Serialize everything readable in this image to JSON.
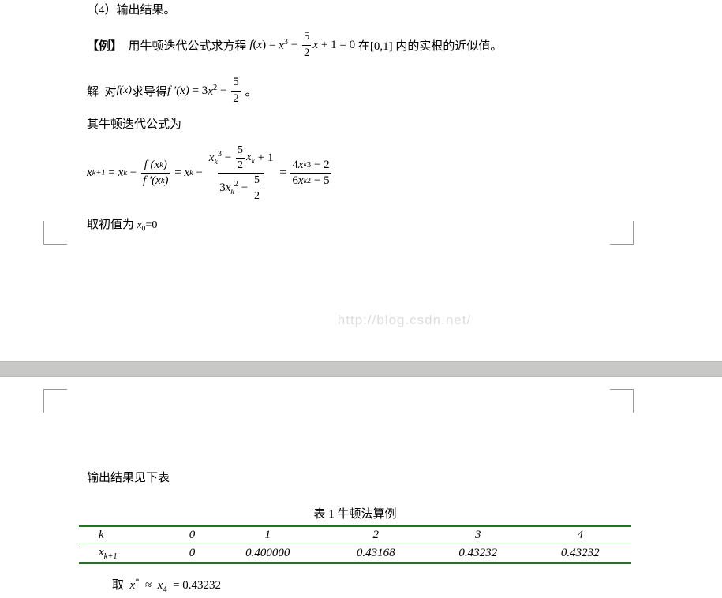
{
  "p1": {
    "step4": "（4）输出结果。",
    "example_prefix": "【例】",
    "example_text1": "  用牛顿迭代公式求方程 ",
    "f_eq_left": "f",
    "f_eq_paren": "(",
    "f_eq_x": "x",
    "f_eq_close": ")",
    "eq_sign": " = ",
    "x_cubed_base": "x",
    "x_cubed_exp": "3",
    "minus": " − ",
    "frac52_num": "5",
    "frac52_den": "2",
    "x_after": "x",
    "plus1": " + 1 = 0 ",
    "example_text2": "在[0,1] 内的实根的近似值。",
    "solve_prefix": "解",
    "solve_text1": "  对",
    "fx_txt": "f(x)",
    "solve_text2": "求导得 ",
    "fprime": "f ′",
    "fprime_x": "(x)",
    "eq_3x2": " = 3",
    "x2_x": "x",
    "x2_2": "2",
    "period": " 。",
    "newton_label": "其牛顿迭代公式为",
    "xk1": "x",
    "xk1_sub": "k+1",
    "xk": "x",
    "xk_sub": "k",
    "fx_k_num": "f (x",
    "fx_k_num_sub": "k",
    "fx_k_num_close": ")",
    "fpx_k_den": "f ′(x",
    "fpx_k_den_sub": "k",
    "fpx_k_den_close": ")",
    "num2_x": "x",
    "num2_exp": "3",
    "num2_sub": "k",
    "num2_xk": "x",
    "num2_xk_sub": "k",
    "num2_plus1": " + 1",
    "den2_3x": "3x",
    "den2_sub": "k",
    "den2_exp": "2",
    "final_num": "4x",
    "final_num_sub": "k",
    "final_num_exp": "3",
    "final_num_m2": " − 2",
    "final_den": "6x",
    "final_den_sub": "k",
    "final_den_exp": "2",
    "final_den_m5": " − 5",
    "init_val": "取初值为 ",
    "x0": "x",
    "x0_sub": "0",
    "eq0": "=0"
  },
  "watermark": "http://blog.csdn.net/",
  "p2": {
    "output_text": "输出结果见下表",
    "table_caption": "表 1  牛顿法算例",
    "header": [
      "k",
      "0",
      "1",
      "2",
      "3",
      "4"
    ],
    "row": [
      "x",
      "0",
      "0.400000",
      "0.43168",
      "0.43232",
      "0.43232"
    ],
    "row_sub": "k+1",
    "result_prefix": "取 ",
    "xstar": "x",
    "star_sup": "*",
    "approx": " ≈ ",
    "x4": "x",
    "x4_sub": "4",
    "eq_val": " = 0.43232"
  }
}
